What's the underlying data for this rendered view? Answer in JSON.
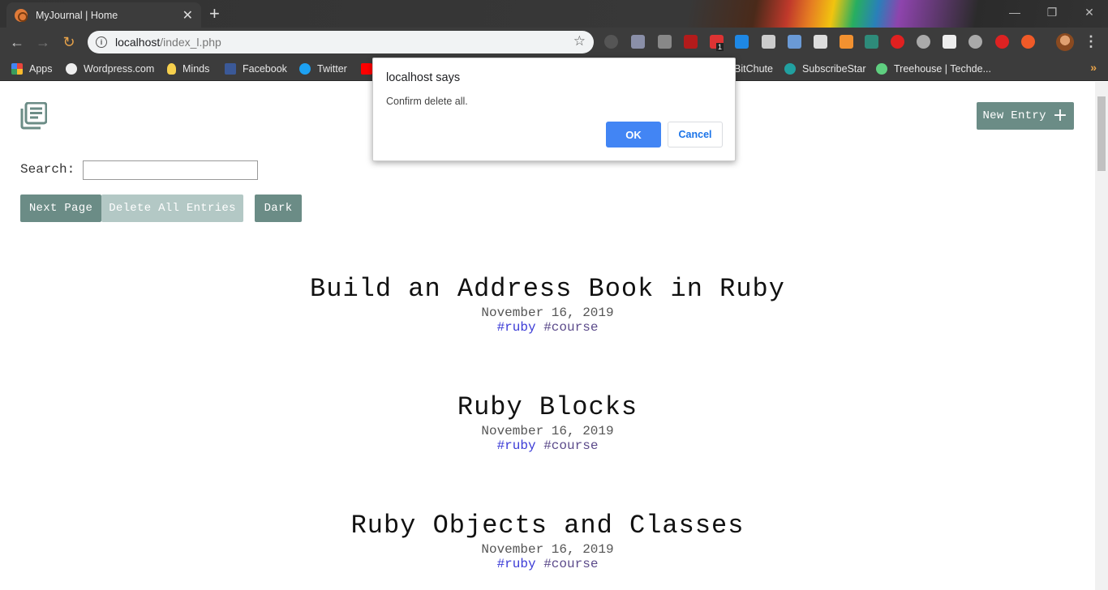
{
  "browser": {
    "tab_title": "MyJournal | Home",
    "tab_close": "✕",
    "new_tab": "+",
    "url_host": "localhost",
    "url_path": "/index_l.php",
    "extension_badge": "1",
    "bookmarks": [
      {
        "label": "Apps",
        "icon": "apps-grid-icon",
        "color": "#e8453c"
      },
      {
        "label": "Wordpress.com",
        "icon": "wordpress-icon",
        "color": "#21759b"
      },
      {
        "label": "Minds",
        "icon": "lightbulb-icon",
        "color": "#f6d04d"
      },
      {
        "label": "Facebook",
        "icon": "facebook-icon",
        "color": "#3b5998"
      },
      {
        "label": "Twitter",
        "icon": "twitter-icon",
        "color": "#1da1f2"
      },
      {
        "label": "BitChute",
        "icon": "bitchute-icon",
        "color": "#ef4137"
      },
      {
        "label": "SubscribeStar",
        "icon": "subscribestar-icon",
        "color": "#21a0a0"
      },
      {
        "label": "Treehouse | Techde...",
        "icon": "treehouse-icon",
        "color": "#5fcf80"
      }
    ],
    "bookmarks_more": "»"
  },
  "page": {
    "new_entry_label": "New Entry",
    "new_entry_plus": "+",
    "search_label": "Search:",
    "search_value": "",
    "next_page_label": "Next Page",
    "delete_all_label": "Delete All Entries",
    "dark_label": "Dark",
    "accent_color": "#6b8c86"
  },
  "entries": [
    {
      "title": "Build an Address Book in Ruby",
      "date": "November 16, 2019",
      "tag1": "#ruby",
      "tag2": "#course"
    },
    {
      "title": "Ruby Blocks",
      "date": "November 16, 2019",
      "tag1": "#ruby",
      "tag2": "#course"
    },
    {
      "title": "Ruby Objects and Classes",
      "date": "November 16, 2019",
      "tag1": "#ruby",
      "tag2": "#course"
    }
  ],
  "dialog": {
    "title": "localhost says",
    "message": "Confirm delete all.",
    "ok_label": "OK",
    "cancel_label": "Cancel"
  }
}
